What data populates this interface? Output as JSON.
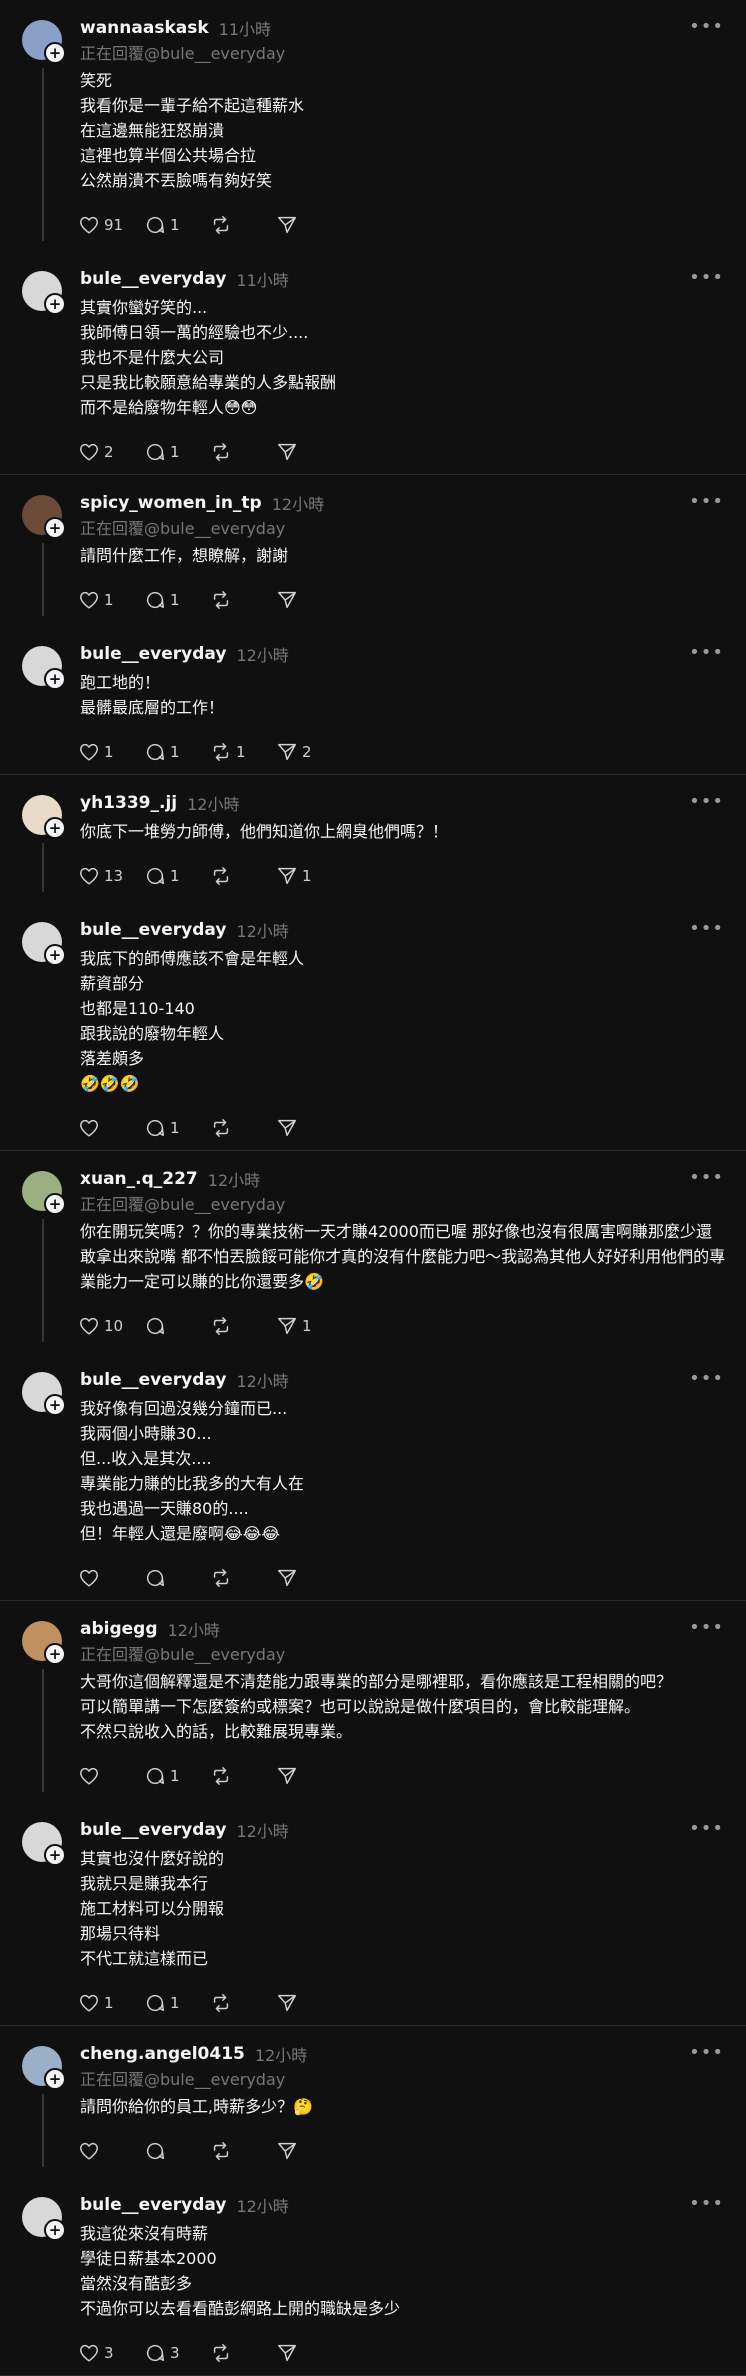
{
  "threads": [
    {
      "posts": [
        {
          "username": "wannaaskask",
          "time": "11小時",
          "replying": "正在回覆@bule__everyday",
          "content": "笑死\n我看你是一輩子給不起這種薪水\n在這邊無能狂怒崩潰\n這裡也算半個公共場合拉\n公然崩潰不丟臉嗎有夠好笑",
          "likes": "91",
          "comments": "1",
          "reposts": "",
          "shares": "",
          "avatar_color": "#8aa0c8"
        },
        {
          "username": "bule__everyday",
          "time": "11小時",
          "replying": "",
          "content": "其實你蠻好笑的...\n我師傅日領一萬的經驗也不少....\n我也不是什麼大公司\n只是我比較願意給專業的人多點報酬\n而不是給廢物年輕人😳😳",
          "likes": "2",
          "comments": "1",
          "reposts": "",
          "shares": "",
          "avatar_color": "#d8d8d8"
        }
      ]
    },
    {
      "posts": [
        {
          "username": "spicy_women_in_tp",
          "time": "12小時",
          "replying": "正在回覆@bule__everyday",
          "content": "請問什麼工作，想瞭解，謝謝",
          "likes": "1",
          "comments": "1",
          "reposts": "",
          "shares": "",
          "avatar_color": "#6b4a3a"
        },
        {
          "username": "bule__everyday",
          "time": "12小時",
          "replying": "",
          "content": "跑工地的！\n最髒最底層的工作！",
          "likes": "1",
          "comments": "1",
          "reposts": "1",
          "shares": "2",
          "avatar_color": "#d8d8d8"
        }
      ]
    },
    {
      "posts": [
        {
          "username": "yh1339_.jj",
          "time": "12小時",
          "replying": "",
          "content": "你底下一堆勞力師傅，他們知道你上網臭他們嗎？！",
          "likes": "13",
          "comments": "1",
          "reposts": "",
          "shares": "1",
          "avatar_color": "#e8dcc8"
        },
        {
          "username": "bule__everyday",
          "time": "12小時",
          "replying": "",
          "content": "我底下的師傅應該不會是年輕人\n薪資部分\n也都是110-140\n跟我說的廢物年輕人\n落差頗多\n🤣🤣🤣",
          "likes": "",
          "comments": "1",
          "reposts": "",
          "shares": "",
          "avatar_color": "#d8d8d8"
        }
      ]
    },
    {
      "posts": [
        {
          "username": "xuan_.q_227",
          "time": "12小時",
          "replying": "正在回覆@bule__everyday",
          "content": "你在開玩笑嗎？？你的專業技術一天才賺42000而已喔 那好像也沒有很厲害啊賺那麼少還敢拿出來說嘴 都不怕丟臉餒可能你才真的沒有什麼能力吧～我認為其他人好好利用他們的專業能力一定可以賺的比你還要多🤣",
          "likes": "10",
          "comments": "",
          "reposts": "",
          "shares": "1",
          "avatar_color": "#9ab080"
        },
        {
          "username": "bule__everyday",
          "time": "12小時",
          "replying": "",
          "content": "我好像有回過沒幾分鐘而已...\n我兩個小時賺30...\n但...收入是其次....\n專業能力賺的比我多的大有人在\n我也遇過一天賺80的....\n但！年輕人還是廢啊😂😂😂",
          "likes": "",
          "comments": "",
          "reposts": "",
          "shares": "",
          "avatar_color": "#d8d8d8"
        }
      ]
    },
    {
      "posts": [
        {
          "username": "abigegg",
          "time": "12小時",
          "replying": "正在回覆@bule__everyday",
          "content": "大哥你這個解釋還是不清楚能力跟專業的部分是哪裡耶，看你應該是工程相關的吧？\n可以簡單講一下怎麼簽約或標案？也可以說說是做什麼項目的，會比較能理解。\n不然只說收入的話，比較難展現專業。",
          "likes": "",
          "comments": "1",
          "reposts": "",
          "shares": "",
          "avatar_color": "#c09060"
        },
        {
          "username": "bule__everyday",
          "time": "12小時",
          "replying": "",
          "content": "其實也沒什麼好說的\n我就只是賺我本行\n施工材料可以分開報\n那場只待料\n不代工就這樣而已",
          "likes": "1",
          "comments": "1",
          "reposts": "",
          "shares": "",
          "avatar_color": "#d8d8d8"
        }
      ]
    },
    {
      "posts": [
        {
          "username": "cheng.angel0415",
          "time": "12小時",
          "replying": "正在回覆@bule__everyday",
          "content": "請問你給你的員工,時薪多少？🤔",
          "likes": "",
          "comments": "",
          "reposts": "",
          "shares": "",
          "avatar_color": "#9ab0c8"
        },
        {
          "username": "bule__everyday",
          "time": "12小時",
          "replying": "",
          "content": "我這從來沒有時薪\n學徒日薪基本2000\n當然沒有酷彭多\n不過你可以去看看酷彭網路上開的職缺是多少",
          "likes": "3",
          "comments": "3",
          "reposts": "",
          "shares": "",
          "avatar_color": "#d8d8d8"
        }
      ]
    }
  ],
  "icons": {
    "like": "heart-icon",
    "comment": "comment-icon",
    "repost": "repost-icon",
    "share": "share-icon",
    "more": "more-icon"
  }
}
